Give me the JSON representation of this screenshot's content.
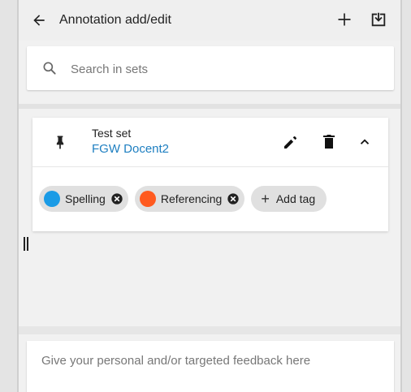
{
  "header": {
    "title": "Annotation add/edit",
    "back_icon": "arrow-left-icon",
    "add_icon": "plus-icon",
    "download_icon": "download-box-icon"
  },
  "search": {
    "placeholder": "Search in sets"
  },
  "set": {
    "title": "Test set",
    "subtitle": "FGW Docent2"
  },
  "tags": [
    {
      "label": "Spelling",
      "color": "#1a9be6"
    },
    {
      "label": "Referencing",
      "color": "#ff5a1f"
    }
  ],
  "add_tag_label": "Add tag",
  "feedback": {
    "placeholder": "Give your personal and/or targeted feedback here"
  }
}
